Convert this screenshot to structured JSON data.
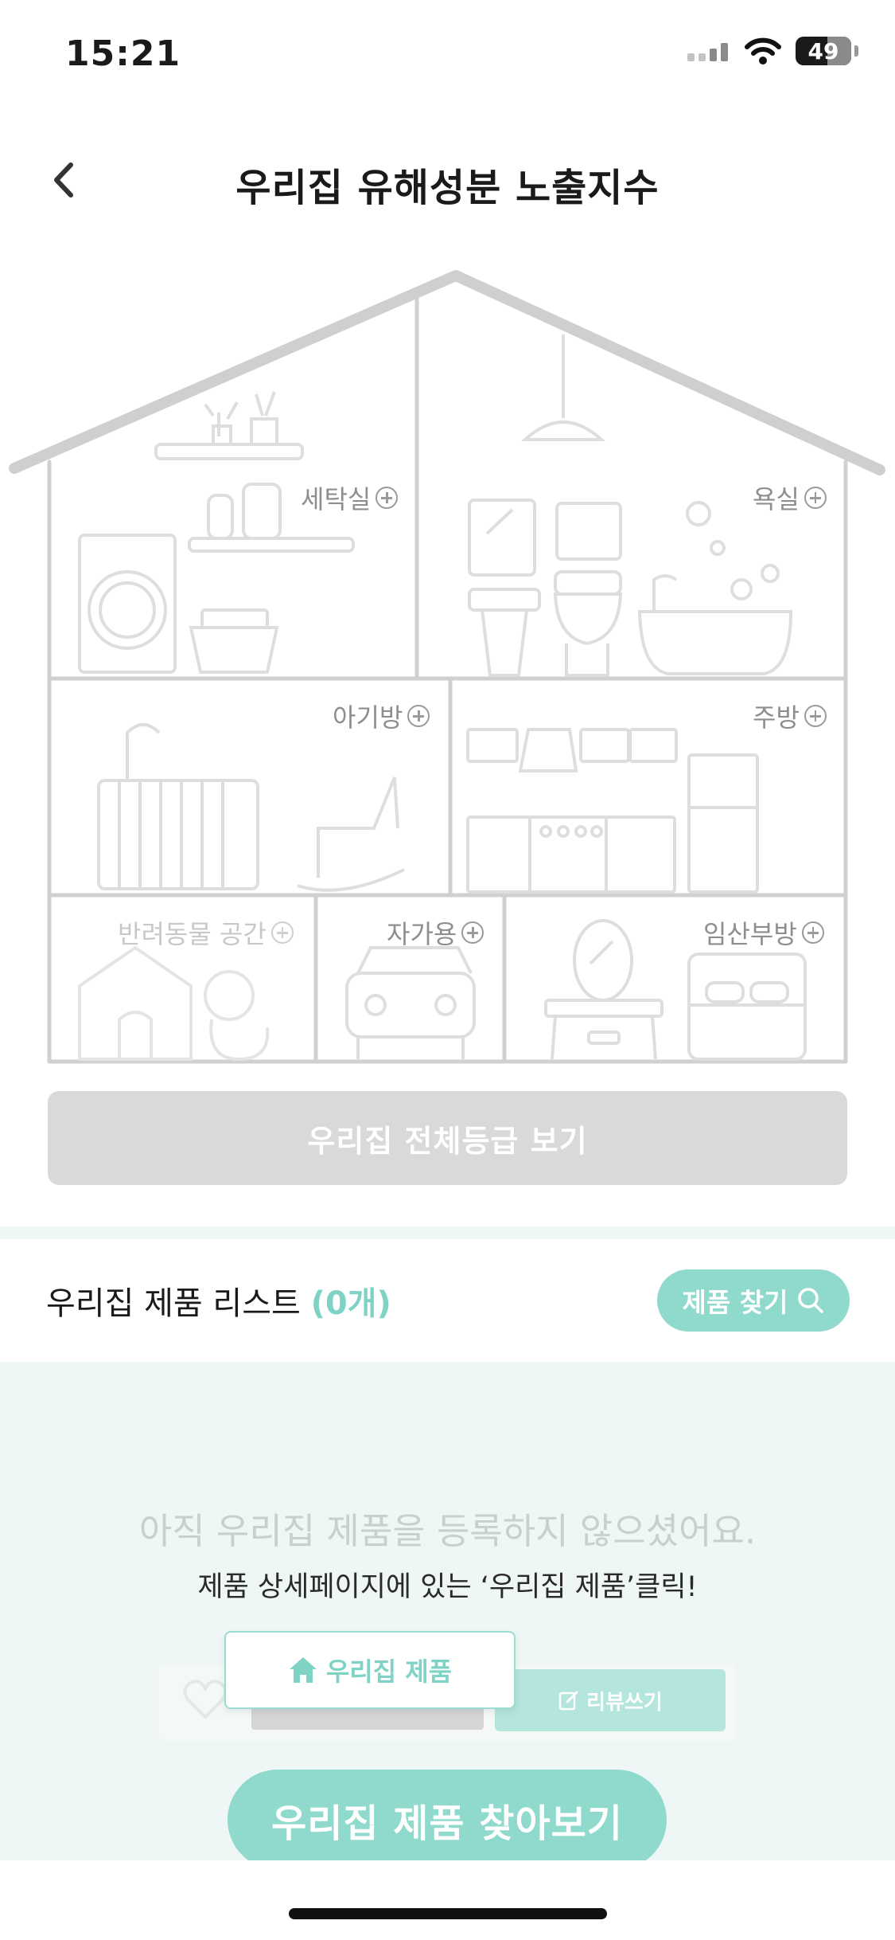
{
  "status_bar": {
    "time": "15:21",
    "battery": "49"
  },
  "header": {
    "title": "우리집 유해성분 노출지수"
  },
  "house": {
    "rooms": [
      {
        "id": "laundry",
        "label": "세탁실"
      },
      {
        "id": "bathroom",
        "label": "욕실"
      },
      {
        "id": "baby-room",
        "label": "아기방"
      },
      {
        "id": "kitchen",
        "label": "주방"
      },
      {
        "id": "pet-space",
        "label": "반려동물 공간"
      },
      {
        "id": "car",
        "label": "자가용"
      },
      {
        "id": "maternity-room",
        "label": "임산부방"
      }
    ]
  },
  "grade_button": {
    "label": "우리집 전체등급 보기"
  },
  "product_list": {
    "title": "우리집 제품 리스트",
    "count": "(0개)",
    "find_button": "제품 찾기"
  },
  "empty_state": {
    "line1": "아직 우리집 제품을 등록하지 않으셨어요.",
    "line2": "제품 상세페이지에 있는 ‘우리집 제품’클릭!",
    "popup_label": "우리집 제품",
    "review_label": "리뷰쓰기",
    "cta_label": "우리집 제품 찾아보기"
  },
  "colors": {
    "accent": "#8fd9cd",
    "accent_text": "#7fd3c6",
    "disabled": "#d9d9d9",
    "soft_bg": "#eef7f5"
  }
}
